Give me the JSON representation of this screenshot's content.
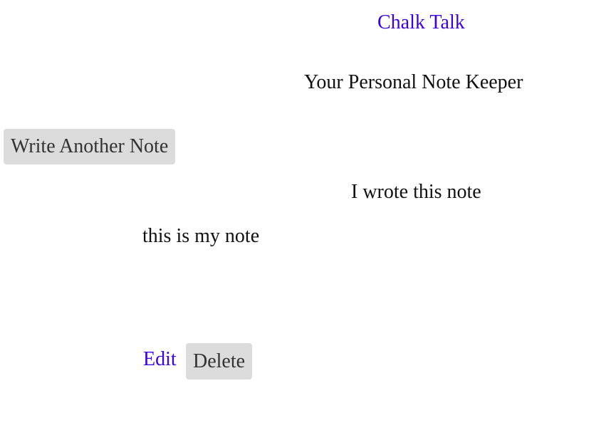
{
  "header": {
    "app_title": "Chalk Talk",
    "tagline": "Your Personal Note Keeper"
  },
  "actions": {
    "write_note_label": "Write Another Note"
  },
  "note": {
    "title": "I wrote this note",
    "body": "this is my note",
    "edit_label": "Edit",
    "delete_label": "Delete"
  },
  "colors": {
    "link": "#3b00e6",
    "button_bg": "#dcdcdc"
  }
}
